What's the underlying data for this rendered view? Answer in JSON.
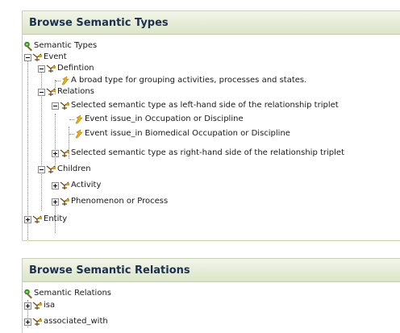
{
  "types_panel": {
    "title": "Browse Semantic Types",
    "root": "Semantic Types",
    "event": "Event",
    "definition": "Defintion",
    "definition_text": "A broad type for grouping activities, processes and states.",
    "relations": "Relations",
    "lhs": "Selected semantic type as left-hand side of the relationship triplet",
    "lhs_item_1": "Event issue_in Occupation or Discipline",
    "lhs_item_2": "Event issue_in Biomedical Occupation or Discipline",
    "rhs": "Selected semantic type as right-hand side of the relationship triplet",
    "children": "Children",
    "activity": "Activity",
    "phenomenon": "Phenomenon or Process",
    "entity": "Entity"
  },
  "relations_panel": {
    "title": "Browse Semantic Relations",
    "root": "Semantic Relations",
    "isa": "isa",
    "associated_with": "associated_with"
  },
  "icons": {
    "root": "tree-root-icon",
    "node": "semantic-type-icon",
    "leaf": "definition-leaf-icon"
  }
}
